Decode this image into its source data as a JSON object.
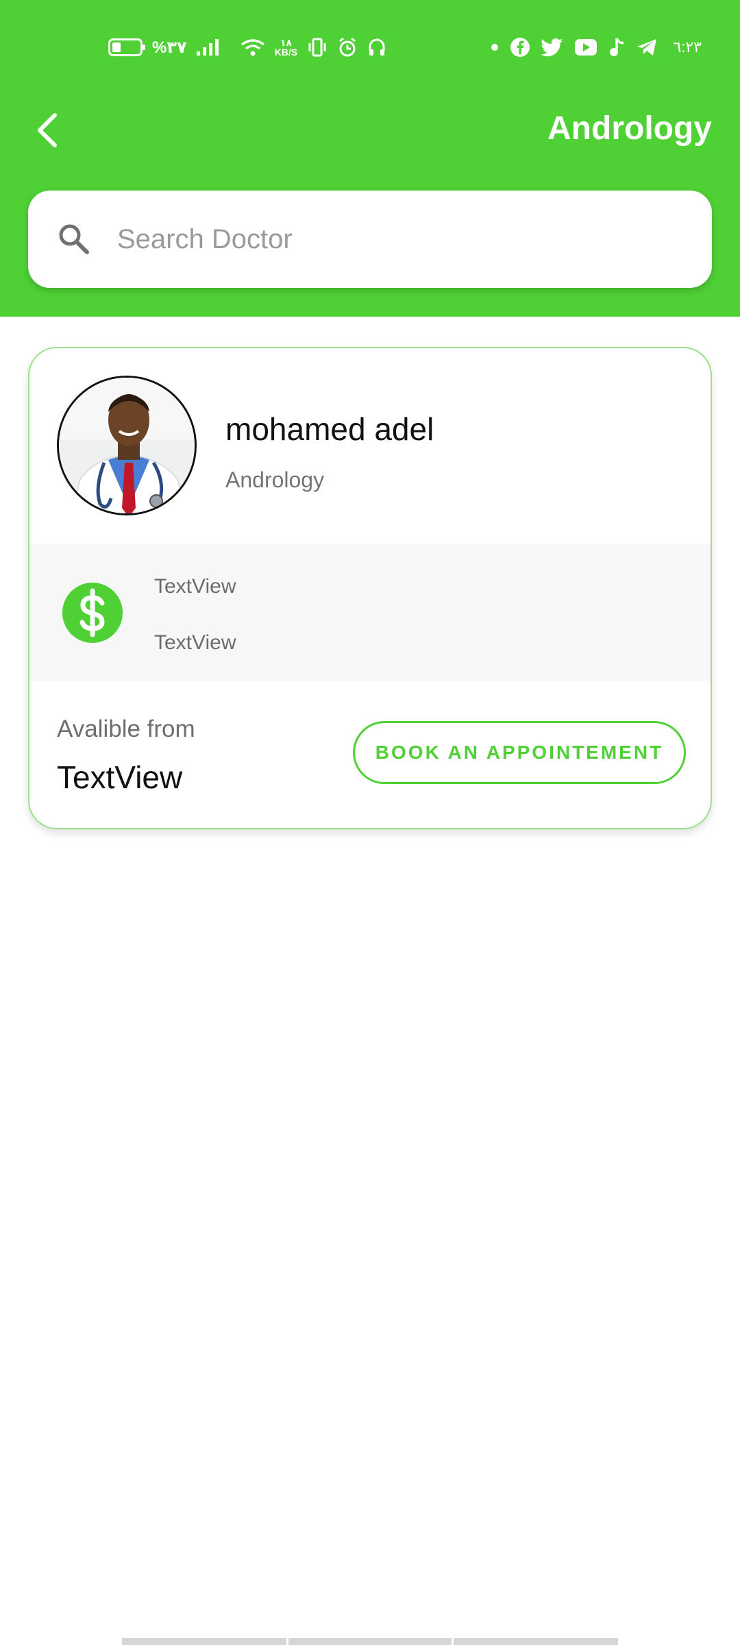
{
  "colors": {
    "accent": "#4fd035",
    "card_border": "#9de08b"
  },
  "status_bar": {
    "battery_percent": "%٣٧",
    "network_speed_top": "١٨",
    "network_speed_bottom": "KB/S",
    "time": "٦:٢٣",
    "icons_left": [
      "battery-icon",
      "signal-icon",
      "wifi-icon",
      "network-speed",
      "vibrate-icon",
      "alarm-icon",
      "headset-icon"
    ],
    "icons_right": [
      "dot-icon",
      "facebook-icon",
      "twitter-icon",
      "youtube-icon",
      "music-icon",
      "telegram-icon"
    ]
  },
  "header": {
    "back_icon": "chevron-left-icon",
    "title": "Andrology"
  },
  "search": {
    "icon": "search-icon",
    "placeholder": "Search Doctor",
    "value": ""
  },
  "doctor_card": {
    "name": "mohamed adel",
    "specialty": "Andrology",
    "avatar": "doctor-avatar",
    "price_icon": "dollar-icon",
    "price_line_1": "TextView",
    "price_line_2": "TextView",
    "available_label": "Avalible from",
    "available_value": "TextView",
    "book_button_label": "BOOK AN APPOINTEMENT"
  }
}
